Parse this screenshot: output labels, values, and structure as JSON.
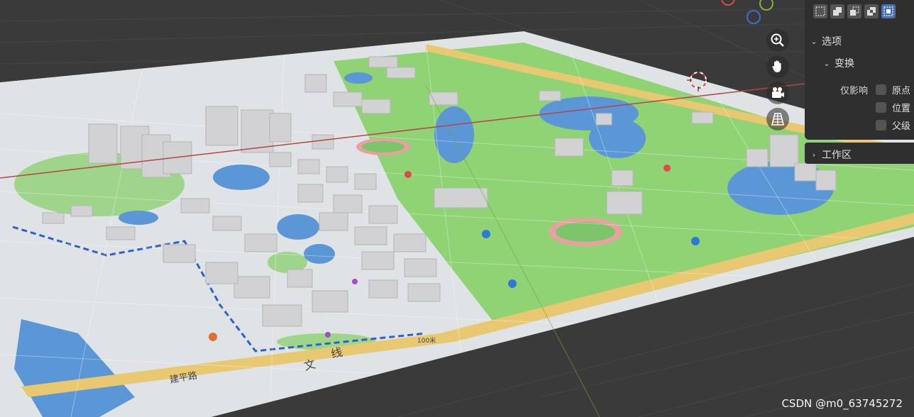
{
  "panel": {
    "options_label": "选项",
    "transform_label": "变换",
    "affect_only_label": "仅影响",
    "checkboxes": [
      {
        "label": "原点",
        "checked": false
      },
      {
        "label": "位置",
        "checked": false
      },
      {
        "label": "父级",
        "checked": false
      }
    ],
    "workspace_label": "工作区"
  },
  "map_labels": {
    "road_1": "建平路",
    "road_2": "线",
    "road_3": "文",
    "scale": "100米"
  },
  "watermark": "CSDN @m0_63745272",
  "colors": {
    "grid_floor": "#3a3a3a",
    "panel_bg": "#2f2f2f",
    "active_mode": "#4772b3",
    "park_green": "#8fd375",
    "water_blue": "#5b97d6",
    "building_gray": "#d2d2d4",
    "road_yellow": "#e8c870",
    "axis_red": "#b94444"
  },
  "icons": {
    "nav": [
      "zoom-icon",
      "hand-pan-icon",
      "camera-icon",
      "perspective-grid-icon"
    ],
    "modes": [
      "select-new-icon",
      "select-extend-icon",
      "select-subtract-icon",
      "select-difference-icon",
      "select-intersect-icon"
    ]
  }
}
